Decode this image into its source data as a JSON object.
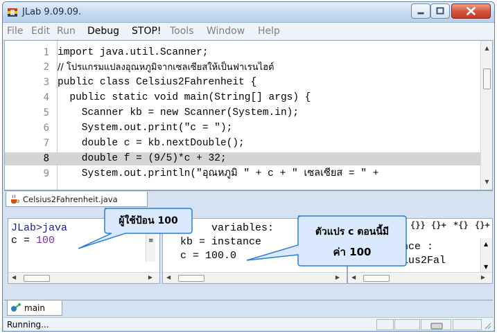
{
  "window": {
    "title": "JLab 9.09.09.",
    "icon": "jlab-app-icon"
  },
  "window_controls": {
    "minimize": "minimize-icon",
    "maximize": "maximize-icon",
    "close": "close-icon"
  },
  "menu": [
    {
      "label": "File",
      "enabled": false
    },
    {
      "label": "Edit",
      "enabled": false
    },
    {
      "label": "Run",
      "enabled": false
    },
    {
      "label": "Debug",
      "enabled": true
    },
    {
      "label": "STOP!",
      "enabled": true
    },
    {
      "label": "Tools",
      "enabled": false
    },
    {
      "label": "Window",
      "enabled": false
    },
    {
      "label": "Help",
      "enabled": false
    }
  ],
  "editor": {
    "current_line": 8,
    "lines": [
      {
        "num": "1",
        "text": "import java.util.Scanner;"
      },
      {
        "num": "2",
        "text": "// โปรแกรมแปลงอุณหภูมิจากเซลเซียสให้เป็นฟาเรนไฮต์"
      },
      {
        "num": "3",
        "text": "public class Celsius2Fahrenheit {"
      },
      {
        "num": "4",
        "text": "  public static void main(String[] args) {"
      },
      {
        "num": "5",
        "text": "    Scanner kb = new Scanner(System.in);"
      },
      {
        "num": "6",
        "text": "    System.out.print(\"c = \");"
      },
      {
        "num": "7",
        "text": "    double c = kb.nextDouble();"
      },
      {
        "num": "8",
        "text": "    double f = (9/5)*c + 32;"
      },
      {
        "num": "9",
        "text": "    System.out.println(\"อุณหภูมิ \" + c + \" เซลเซียส = \" +"
      }
    ]
  },
  "file_tab": {
    "label": "Celsius2Fahrenheit.java",
    "icon": "java-cup-icon"
  },
  "console": {
    "line1": "JLab>java",
    "line2_prefix": "c = ",
    "line2_value": "100"
  },
  "variables": {
    "header": "variables:",
    "line1": "kb = instance",
    "line2": "c = 100.0"
  },
  "sequence": {
    "line1": "uence :",
    "line2": "lsius2Fal"
  },
  "debug_toolbar": {
    "icons": [
      "step-into-icon",
      "step-over-icon",
      "step-out-icon",
      "step-return-icon"
    ]
  },
  "main_tab": {
    "label": "main",
    "icon": "thread-icon"
  },
  "status": {
    "text": "Running..."
  },
  "callouts": [
    {
      "text": "ผู้ใช้ป้อน 100"
    },
    {
      "line1": "ตัวแปร c ตอนนี้มี",
      "line2": "ค่า 100"
    }
  ],
  "colors": {
    "callout_fill": "#dbe9ff",
    "callout_border": "#2a7fd4",
    "value_purple": "#7b2fa8",
    "highlight_line": "#d4d4d4"
  }
}
